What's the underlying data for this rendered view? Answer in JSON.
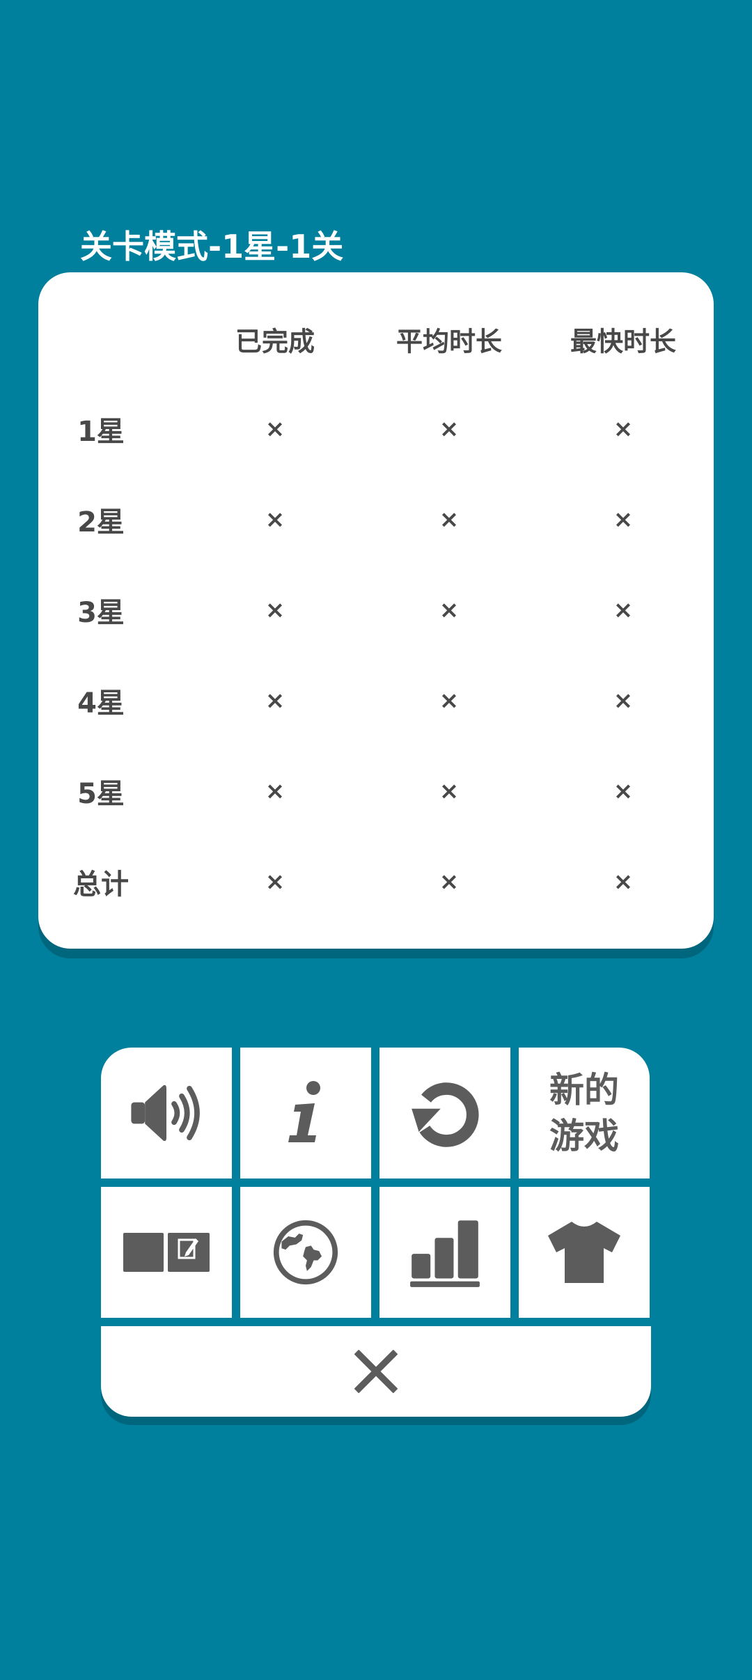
{
  "stats": {
    "title": "关卡模式-1星-1关",
    "columns": [
      "已完成",
      "平均时长",
      "最快时长"
    ],
    "rows": [
      {
        "label": "1星",
        "values": [
          "×",
          "×",
          "×"
        ]
      },
      {
        "label": "2星",
        "values": [
          "×",
          "×",
          "×"
        ]
      },
      {
        "label": "3星",
        "values": [
          "×",
          "×",
          "×"
        ]
      },
      {
        "label": "4星",
        "values": [
          "×",
          "×",
          "×"
        ]
      },
      {
        "label": "5星",
        "values": [
          "×",
          "×",
          "×"
        ]
      },
      {
        "label": "总计",
        "values": [
          "×",
          "×",
          "×"
        ]
      }
    ]
  },
  "menu": {
    "new_game_label": "新的游戏",
    "icons": [
      "speaker-icon",
      "info-icon",
      "restart-icon",
      "notes-toggle-icon",
      "globe-icon",
      "stats-bars-icon",
      "shirt-icon",
      "close-icon"
    ]
  },
  "colors": {
    "background": "#00809c",
    "card": "#ffffff",
    "text": "#484848",
    "icon": "#5c5c5c"
  }
}
